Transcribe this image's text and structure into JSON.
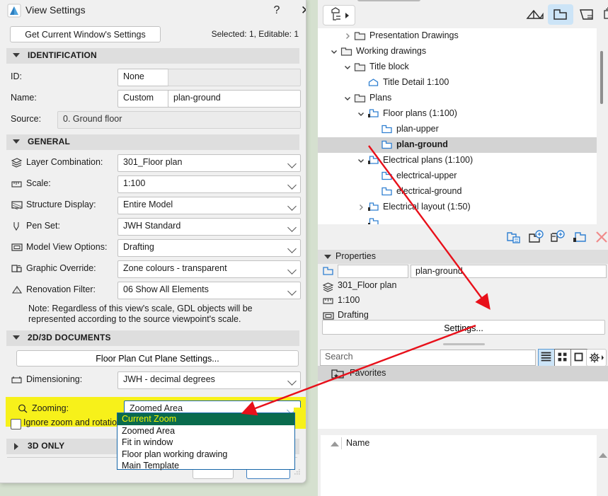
{
  "dialog": {
    "title": "View Settings",
    "help_label": "?",
    "close_label": "✕",
    "get_settings_label": "Get Current Window's Settings",
    "selection_info": "Selected: 1, Editable: 1",
    "sections": {
      "identification": "IDENTIFICATION",
      "general": "GENERAL",
      "documents": "2D/3D DOCUMENTS",
      "three_d_only": "3D ONLY"
    },
    "identification": {
      "id_label": "ID:",
      "id_value": "None",
      "id_text": "",
      "name_label": "Name:",
      "name_value": "Custom",
      "name_text": "plan-ground",
      "source_label": "Source:",
      "source_value": "0. Ground floor"
    },
    "general": [
      {
        "label": "Layer Combination:",
        "value": "301_Floor plan",
        "icon": "layers-icon"
      },
      {
        "label": "Scale:",
        "value": "1:100",
        "icon": "ruler-icon"
      },
      {
        "label": "Structure Display:",
        "value": "Entire Model",
        "icon": "structure-icon"
      },
      {
        "label": "Pen Set:",
        "value": "JWH Standard",
        "icon": "pen-icon"
      },
      {
        "label": "Model View Options:",
        "value": "Drafting",
        "icon": "model-view-icon"
      },
      {
        "label": "Graphic Override:",
        "value": "Zone colours - transparent",
        "icon": "graphic-override-icon"
      },
      {
        "label": "Renovation Filter:",
        "value": "06 Show All Elements",
        "icon": "renovation-icon"
      }
    ],
    "note": "Note: Regardless of this view's scale, GDL objects will be represented according to the source viewpoint's scale.",
    "documents": {
      "cut_plane_label": "Floor Plan Cut Plane Settings...",
      "dimensioning_label": "Dimensioning:",
      "dimensioning_value": "JWH - decimal degrees",
      "zooming_label": "Zooming:",
      "zooming_value": "Zoomed Area",
      "ignore_checkbox_label": "Ignore zoom and rotation",
      "ignore_checked": false
    },
    "zoom_dropdown": {
      "options": [
        "Current Zoom",
        "Zoomed Area",
        "Fit in window",
        "Floor plan working drawing",
        "Main Template"
      ],
      "highlighted": "Current Zoom"
    },
    "footer": {
      "cancel_label": "",
      "ok_label": ""
    }
  },
  "navigator": {
    "menu_button": "navigator-menu",
    "tabs": [
      {
        "name": "project-map-tab",
        "active": false
      },
      {
        "name": "view-map-tab",
        "active": true
      },
      {
        "name": "layout-book-tab",
        "active": false
      },
      {
        "name": "publisher-sets-tab",
        "active": false
      }
    ],
    "tree": [
      {
        "label": "Presentation Drawings",
        "indent": 1,
        "arrow": "collapsed",
        "icon": "folder-icon",
        "selected": false
      },
      {
        "label": "Working drawings",
        "indent": 0,
        "arrow": "expanded",
        "icon": "folder-icon",
        "selected": false
      },
      {
        "label": "Title block",
        "indent": 1,
        "arrow": "expanded",
        "icon": "folder-icon",
        "selected": false
      },
      {
        "label": "Title Detail 1:100",
        "indent": 2,
        "arrow": "none",
        "icon": "detail-icon",
        "selected": false
      },
      {
        "label": "Plans",
        "indent": 1,
        "arrow": "expanded",
        "icon": "folder-icon",
        "selected": false
      },
      {
        "label": "Floor plans (1:100)",
        "indent": 2,
        "arrow": "expanded",
        "icon": "viewset-icon",
        "selected": false
      },
      {
        "label": "plan-upper",
        "indent": 3,
        "arrow": "none",
        "icon": "view-icon",
        "selected": false
      },
      {
        "label": "plan-ground",
        "indent": 3,
        "arrow": "none",
        "icon": "view-icon",
        "selected": true
      },
      {
        "label": "Electrical plans (1:100)",
        "indent": 2,
        "arrow": "expanded",
        "icon": "viewset-icon",
        "selected": false
      },
      {
        "label": "electrical-upper",
        "indent": 3,
        "arrow": "none",
        "icon": "view-icon",
        "selected": false
      },
      {
        "label": "electrical-ground",
        "indent": 3,
        "arrow": "none",
        "icon": "view-icon",
        "selected": false
      },
      {
        "label": "Electrical layout (1:50)",
        "indent": 2,
        "arrow": "collapsed",
        "icon": "viewset-icon",
        "selected": false
      }
    ],
    "tree_tools": [
      "clone-folder-icon",
      "new-view-icon",
      "new-folder-icon",
      "save-view-icon",
      "delete-icon"
    ],
    "properties": {
      "header": "Properties",
      "id_value": "",
      "name_value": "plan-ground",
      "layer_combination": "301_Floor plan",
      "scale": "1:100",
      "model_view": "Drafting",
      "settings_button": "Settings..."
    },
    "search_placeholder": "Search",
    "view_buttons": [
      "list-view-icon",
      "grid-view-icon",
      "large-icon-view-icon",
      "settings-gear-icon"
    ],
    "favorites_label": "Favorites",
    "list_column_name": "Name"
  },
  "colors": {
    "highlight_yellow": "#f7f11a",
    "dropdown_selected_green": "#0a6b4d",
    "dropdown_selected_text": "#f5f500",
    "annotation_red": "#e8101a",
    "accent_blue": "#1565a8",
    "tab_active_blue": "#cce4f7"
  }
}
